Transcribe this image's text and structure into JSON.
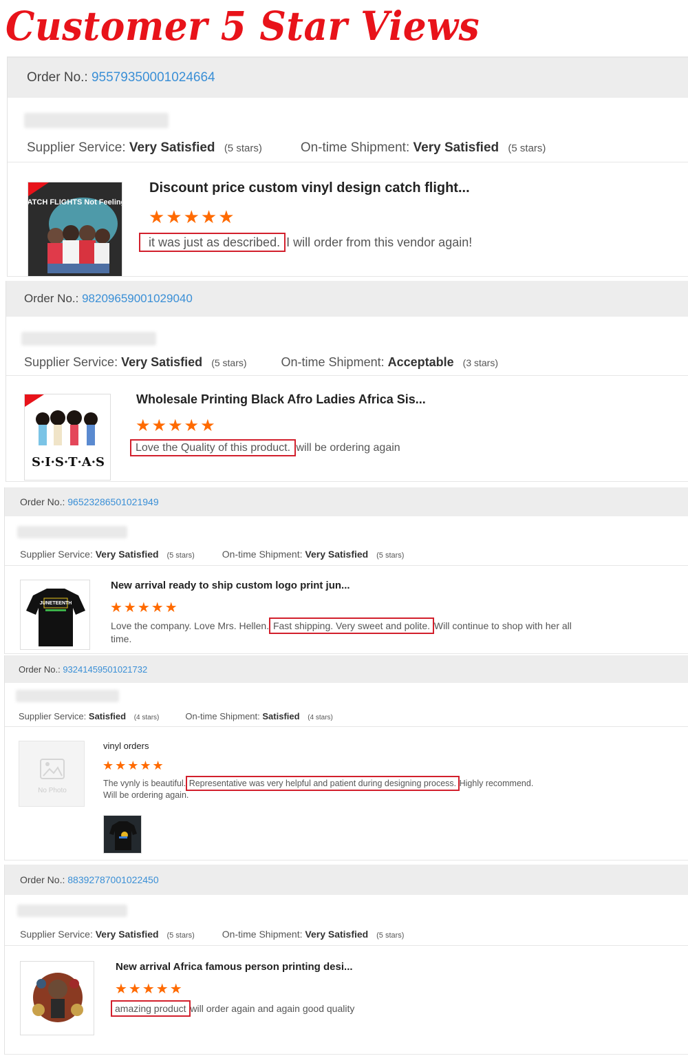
{
  "banner": {
    "title": "Customer 5 Star Views"
  },
  "labels": {
    "order_no": "Order No.:",
    "supplier_service": "Supplier Service:",
    "on_time_shipment": "On-time Shipment:",
    "no_photo": "No Photo"
  },
  "reviews": [
    {
      "order_no": "95579350001024664",
      "supplier_service": "Very Satisfied",
      "supplier_stars": "(5 stars)",
      "shipment": "Very Satisfied",
      "shipment_stars": "(5 stars)",
      "product_title": "Discount price custom vinyl design catch flight...",
      "rating": 5,
      "stars": "★★★★★",
      "review_highlight": "it was just as described.",
      "review_rest": "I will order from this vendor again!",
      "thumb_text": "CATCH FLIGHTS Not Feelings"
    },
    {
      "order_no": "98209659001029040",
      "supplier_service": "Very Satisfied",
      "supplier_stars": "(5 stars)",
      "shipment": "Acceptable",
      "shipment_stars": "(3 stars)",
      "product_title": "Wholesale Printing Black Afro Ladies Africa Sis...",
      "rating": 5,
      "stars": "★★★★★",
      "review_highlight": "Love the Quality of this product.",
      "review_rest": "will be ordering again",
      "thumb_text": "S·I·S·T·A·S"
    },
    {
      "order_no": "96523286501021949",
      "supplier_service": "Very Satisfied",
      "supplier_stars": "(5 stars)",
      "shipment": "Very Satisfied",
      "shipment_stars": "(5 stars)",
      "product_title": "New arrival ready to ship custom logo print jun...",
      "rating": 5,
      "stars": "★★★★★",
      "review_pre": "Love the company.  Love Mrs. Hellen.",
      "review_highlight": "Fast shipping.  Very sweet and polite.",
      "review_rest": "Will continue to shop with her all time.",
      "thumb_text": "JUNETEENTH"
    },
    {
      "order_no": "93241459501021732",
      "supplier_service": "Satisfied",
      "supplier_stars": "(4 stars)",
      "shipment": "Satisfied",
      "shipment_stars": "(4 stars)",
      "product_title": "vinyl orders",
      "rating": 5,
      "stars": "★★★★★",
      "review_pre": "The vynly is beautiful.",
      "review_highlight": "Representative was very helpful and patient during designing process.",
      "review_rest": "Highly recommend. Will be ordering again."
    },
    {
      "order_no": "88392787001022450",
      "supplier_service": "Very Satisfied",
      "supplier_stars": "(5 stars)",
      "shipment": "Very Satisfied",
      "shipment_stars": "(5 stars)",
      "product_title": "New arrival Africa famous person printing desi...",
      "rating": 5,
      "stars": "★★★★★",
      "review_highlight": "amazing product",
      "review_rest": "will order again and again good quality"
    }
  ],
  "colors": {
    "brand_red": "#e8131a",
    "star_orange": "#ff6a00",
    "link_blue": "#3a8fd6",
    "highlight_border": "#d21f2c"
  }
}
